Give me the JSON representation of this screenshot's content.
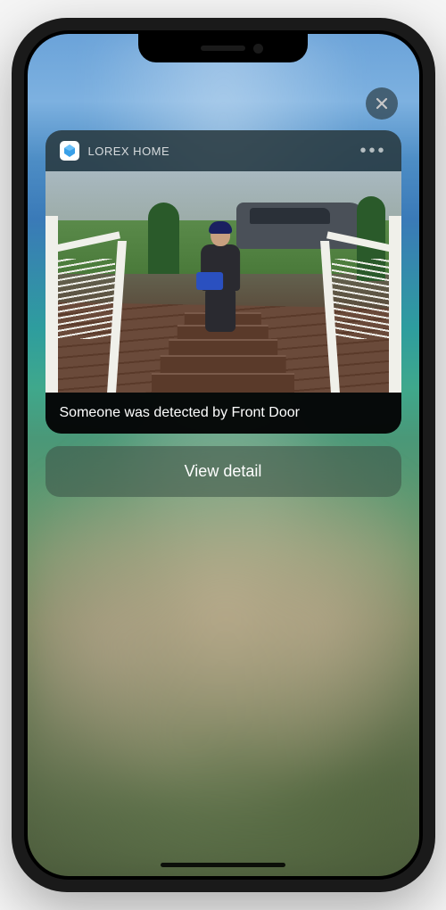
{
  "notification": {
    "app_name": "LOREX HOME",
    "message": "Someone was detected by Front Door",
    "action_label": "View detail"
  }
}
